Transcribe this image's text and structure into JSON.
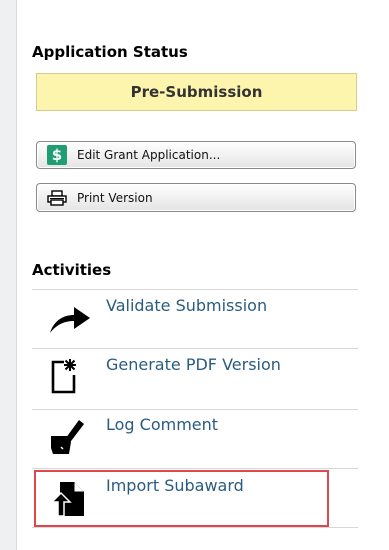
{
  "status_section": {
    "title": "Application Status",
    "status": "Pre-Submission"
  },
  "buttons": {
    "edit": {
      "label": "Edit Grant Application...",
      "icon": "dollar-icon"
    },
    "print": {
      "label": "Print Version",
      "icon": "printer-icon"
    }
  },
  "activities": {
    "title": "Activities",
    "items": [
      {
        "label": "Validate Submission",
        "icon": "arrow-right-icon"
      },
      {
        "label": "Generate PDF Version",
        "icon": "new-document-icon"
      },
      {
        "label": "Log Comment",
        "icon": "pen-comment-icon"
      },
      {
        "label": "Import Subaward",
        "icon": "import-icon"
      }
    ]
  },
  "colors": {
    "status_bg": "#fdf5ae",
    "link": "#2a5b80",
    "highlight": "#e0474c"
  }
}
